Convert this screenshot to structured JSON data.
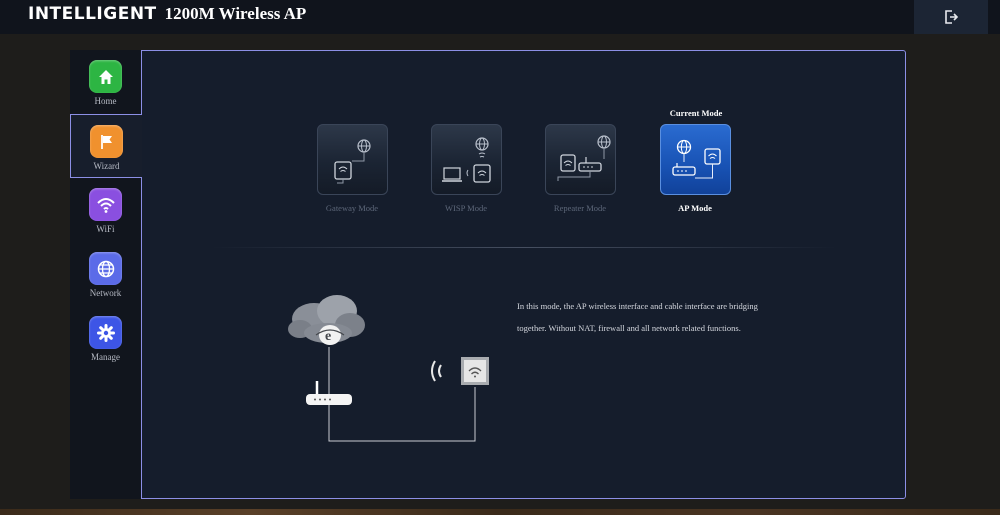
{
  "header": {
    "brand": "INTELLIGENT",
    "model": "1200M Wireless AP",
    "logout_icon": "logout-icon"
  },
  "sidebar": {
    "items": [
      {
        "label": "Home",
        "icon": "home-icon",
        "color": "#2db543",
        "active": false
      },
      {
        "label": "Wizard",
        "icon": "flag-icon",
        "color": "#f0912e",
        "active": true
      },
      {
        "label": "WiFi",
        "icon": "wifi-icon",
        "color": "#8a4fe0",
        "active": false
      },
      {
        "label": "Network",
        "icon": "globe-icon",
        "color": "#5b6be8",
        "active": false
      },
      {
        "label": "Manage",
        "icon": "gear-icon",
        "color": "#3d55e6",
        "active": false
      }
    ]
  },
  "modes": {
    "current_caption": "Current Mode",
    "items": [
      {
        "label": "Gateway Mode",
        "current": false
      },
      {
        "label": "WISP Mode",
        "current": false
      },
      {
        "label": "Repeater Mode",
        "current": false
      },
      {
        "label": "AP Mode",
        "current": true
      }
    ]
  },
  "description": {
    "text": "In this mode, the AP wireless interface and cable interface are bridging together. Without NAT, firewall and all network related functions."
  },
  "colors": {
    "accent_border": "#8c8fe6",
    "current_mode": "#1852b4",
    "panel_bg": "#151d2c"
  }
}
